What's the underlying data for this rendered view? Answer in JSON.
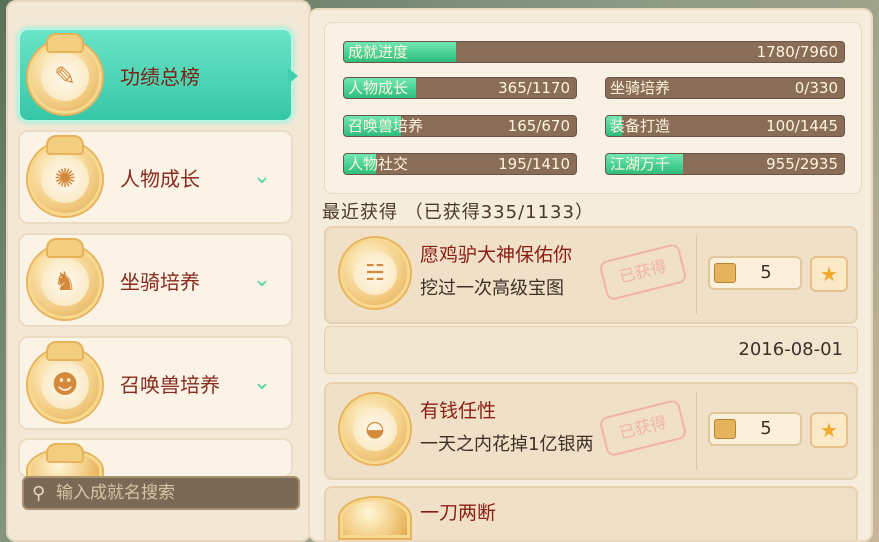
{
  "sidebar": {
    "items": [
      {
        "label": "功绩总榜",
        "icon": "scroll-icon",
        "active": true
      },
      {
        "label": "人物成长",
        "icon": "flame-icon",
        "active": false
      },
      {
        "label": "坐骑培养",
        "icon": "horse-icon",
        "active": false
      },
      {
        "label": "召唤兽培养",
        "icon": "cat-icon",
        "active": false
      },
      {
        "label": "",
        "icon": "medal-icon",
        "active": false
      }
    ]
  },
  "search": {
    "placeholder": "输入成就名搜索"
  },
  "progress": {
    "total": {
      "label": "成就进度",
      "value": "1780/7960",
      "fraction": 0.224
    },
    "categories": [
      {
        "label": "人物成长",
        "value": "365/1170",
        "fraction": 0.312
      },
      {
        "label": "坐骑培养",
        "value": "0/330",
        "fraction": 0.0
      },
      {
        "label": "召唤兽培养",
        "value": "165/670",
        "fraction": 0.246
      },
      {
        "label": "装备打造",
        "value": "100/1445",
        "fraction": 0.069
      },
      {
        "label": "人物社交",
        "value": "195/1410",
        "fraction": 0.138
      },
      {
        "label": "江湖万千",
        "value": "955/2935",
        "fraction": 0.325
      }
    ]
  },
  "recent": {
    "title": "最近获得 （已获得335/1133）",
    "achievements": [
      {
        "name": "愿鸡驴大神保佑你",
        "desc": "挖过一次高级宝图",
        "stamp": "已获得",
        "reward": "5"
      },
      {
        "name": "有钱任性",
        "desc": "一天之内花掉1亿银两",
        "stamp": "已获得",
        "reward": "5"
      }
    ],
    "date": "2016-08-01",
    "partial_name": "一刀两断"
  }
}
